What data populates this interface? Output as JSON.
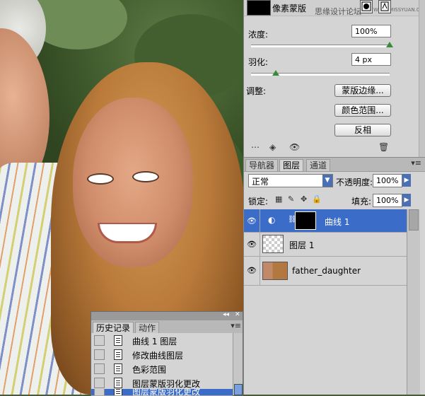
{
  "masks_panel": {
    "title": "像素蒙版",
    "watermark": "思缘设计论坛",
    "watermark_en": "WWW.MISSYUAN.COM",
    "density_label": "浓度:",
    "density_value": "100%",
    "density_level": 1.0,
    "feather_label": "羽化:",
    "feather_value": "4 px",
    "feather_level": 0.18,
    "refine_label": "调整:",
    "buttons": [
      "蒙版边缘...",
      "颜色范围...",
      "反相"
    ]
  },
  "layers_panel": {
    "tabs": [
      "导航器",
      "图层",
      "通道"
    ],
    "active_tab": "图层",
    "blend_mode": "正常",
    "opacity_label": "不透明度:",
    "opacity_value": "100%",
    "lock_label": "锁定:",
    "fill_label": "填充:",
    "fill_value": "100%",
    "layers": [
      {
        "name": "曲线 1",
        "selected": true
      },
      {
        "name": "图层 1",
        "selected": false
      },
      {
        "name": "father_daughter",
        "selected": false
      }
    ]
  },
  "history_panel": {
    "tabs": [
      "历史记录",
      "动作"
    ],
    "items": [
      {
        "label": "曲线 1 图层",
        "selected": false
      },
      {
        "label": "修改曲线图层",
        "selected": false
      },
      {
        "label": "色彩范围",
        "selected": false
      },
      {
        "label": "图层蒙版羽化更改",
        "selected": false
      },
      {
        "label": "图层蒙版羽化更改",
        "selected": true
      }
    ]
  }
}
